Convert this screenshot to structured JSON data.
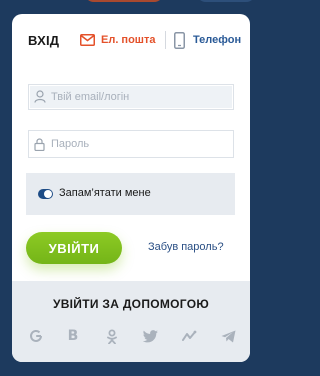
{
  "tabs": {
    "login_label": "ВХІД",
    "email_label": "Ел. пошта",
    "phone_label": "Телефон"
  },
  "form": {
    "email_placeholder": "Твій email/логін",
    "password_placeholder": "Пароль",
    "remember_label": "Запам’ятати мене",
    "remember_checked": true
  },
  "actions": {
    "login_button": "УВІЙТИ",
    "forgot_link": "Забув пароль?"
  },
  "social": {
    "title": "УВІЙТИ ЗА ДОПОМОГОЮ",
    "icons": [
      "google-icon",
      "vk-icon",
      "odnoklassniki-icon",
      "twitter-icon",
      "mailru-icon",
      "telegram-icon"
    ]
  },
  "colors": {
    "accent_orange": "#e4512a",
    "link_blue": "#2a5a97",
    "button_green": "#7fbf1c",
    "panel_gray": "#e7ebf0"
  }
}
